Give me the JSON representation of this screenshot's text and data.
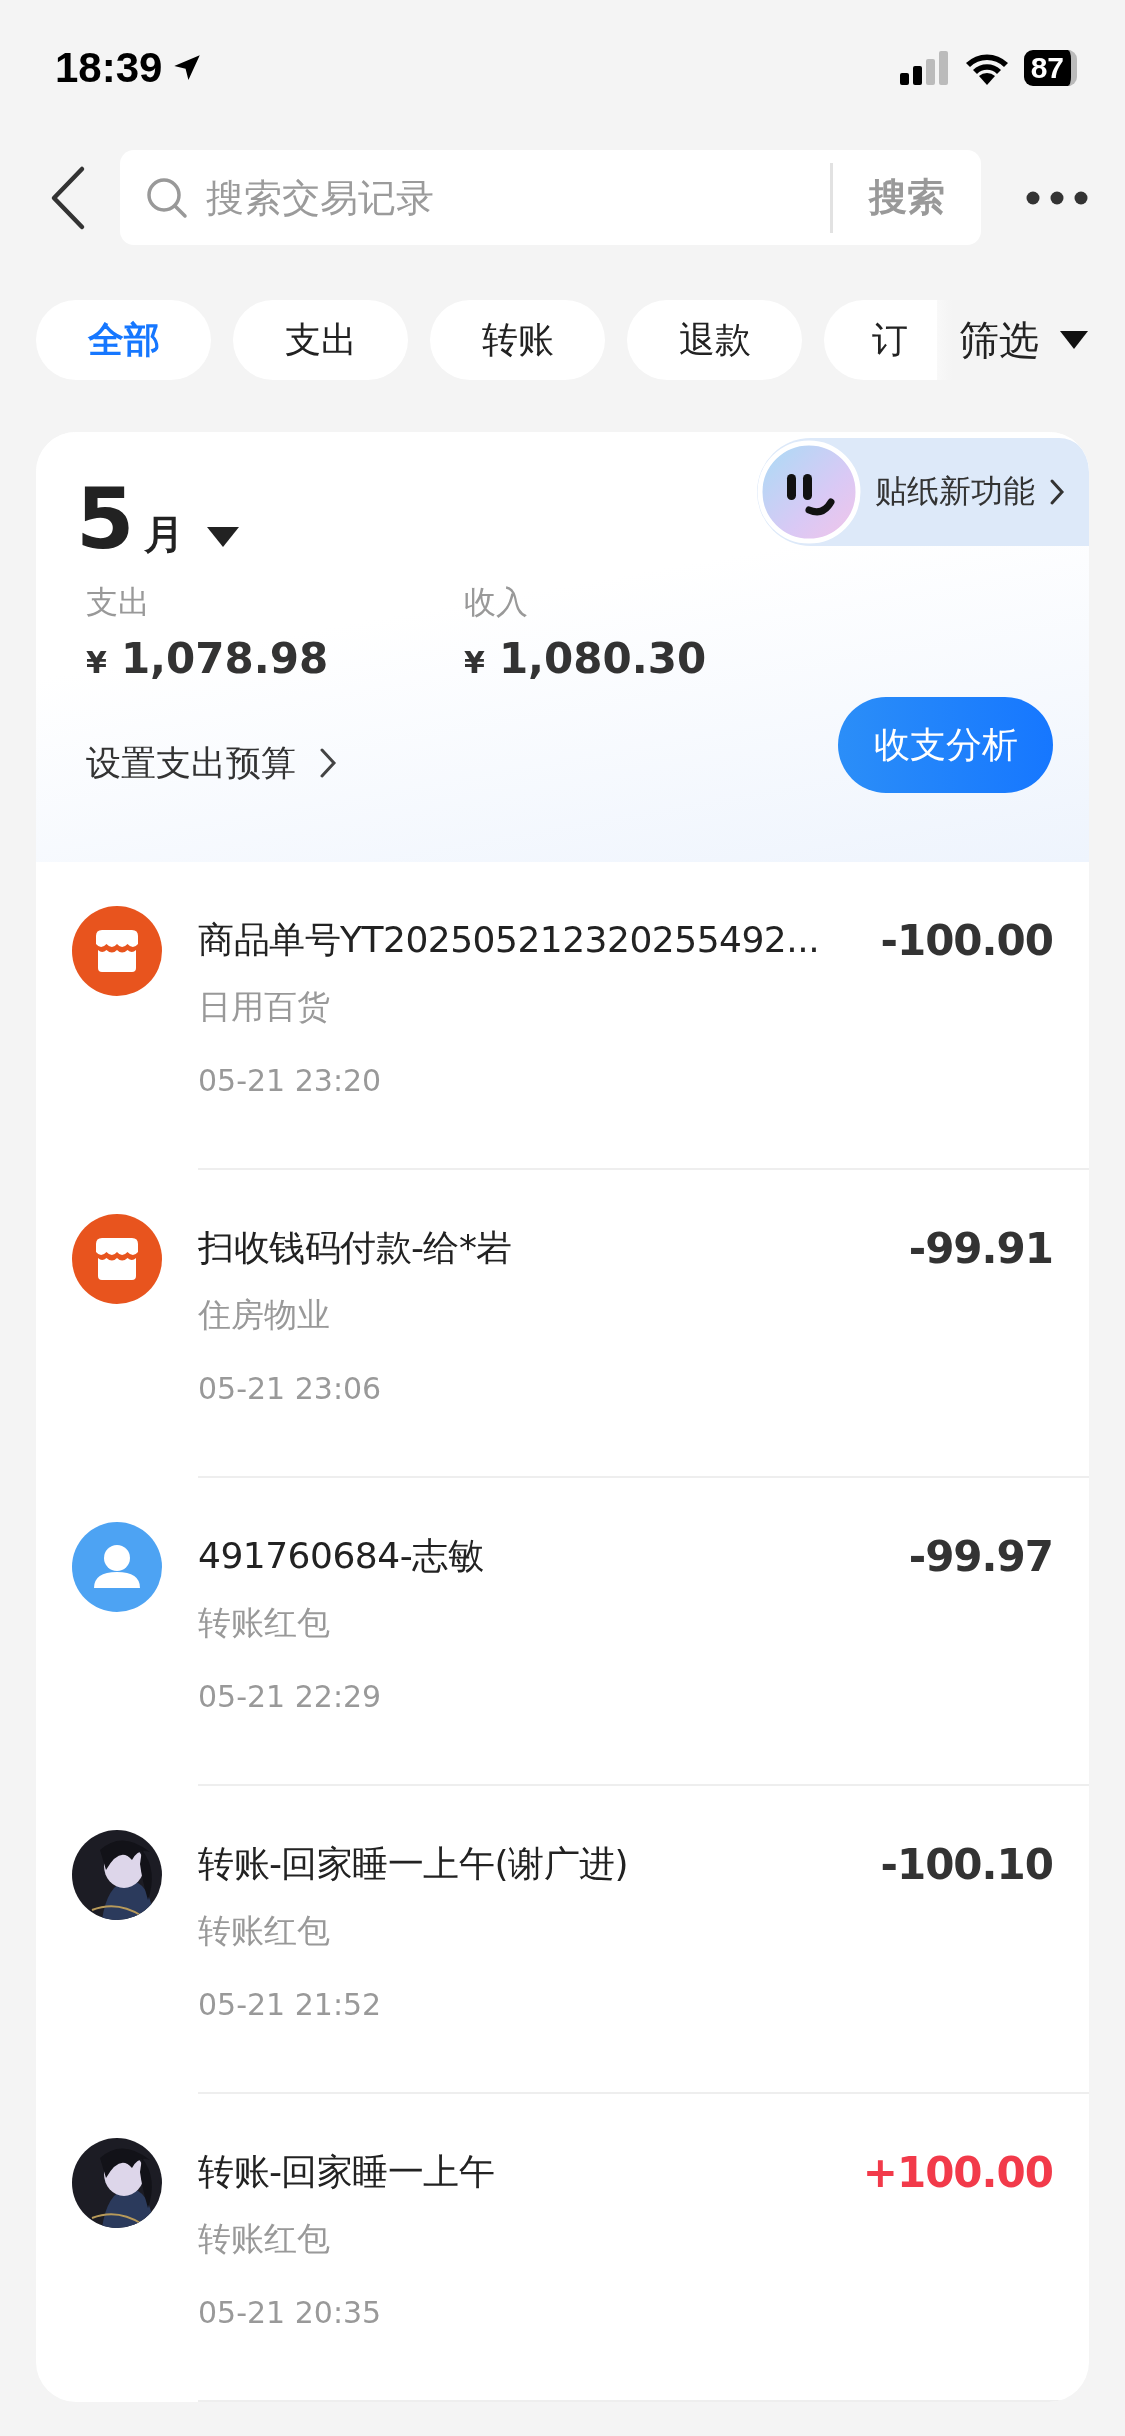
{
  "status_bar": {
    "time": "18:39",
    "battery": "87"
  },
  "search": {
    "placeholder": "搜索交易记录",
    "button": "搜索"
  },
  "filters": [
    {
      "label": "全部",
      "selected": true
    },
    {
      "label": "支出",
      "selected": false
    },
    {
      "label": "转账",
      "selected": false
    },
    {
      "label": "退款",
      "selected": false
    },
    {
      "label": "订",
      "selected": false
    }
  ],
  "filter_menu": {
    "label": "筛选"
  },
  "summary": {
    "month_number": "5",
    "month_unit": "月",
    "sticker_promo": "贴纸新功能",
    "stats": [
      {
        "label": "支出",
        "currency": "¥",
        "amount": "1,078.98"
      },
      {
        "label": "收入",
        "currency": "¥",
        "amount": "1,080.30"
      }
    ],
    "budget_link": "设置支出预算",
    "analysis_button": "收支分析"
  },
  "transactions": [
    {
      "kind": "shop",
      "title": "商品单号YT202505212320255492...",
      "category": "日用百货",
      "time": "05-21 23:20",
      "amount": "-100.00",
      "color": "#333333"
    },
    {
      "kind": "shop",
      "title": "扫收钱码付款-给*岩",
      "category": "住房物业",
      "time": "05-21 23:06",
      "amount": "-99.91",
      "color": "#333333"
    },
    {
      "kind": "person",
      "title": "491760684-志敏",
      "category": "转账红包",
      "time": "05-21 22:29",
      "amount": "-99.97",
      "color": "#333333"
    },
    {
      "title": "转账-回家睡一上午(谢广进)",
      "category": "转账红包",
      "time": "05-21 21:52",
      "amount": "-100.10",
      "color": "#333333"
    },
    {
      "title": "转账-回家睡一上午",
      "category": "转账红包",
      "time": "05-21 20:35",
      "amount": "+100.00",
      "color": "#f23a4a"
    }
  ]
}
